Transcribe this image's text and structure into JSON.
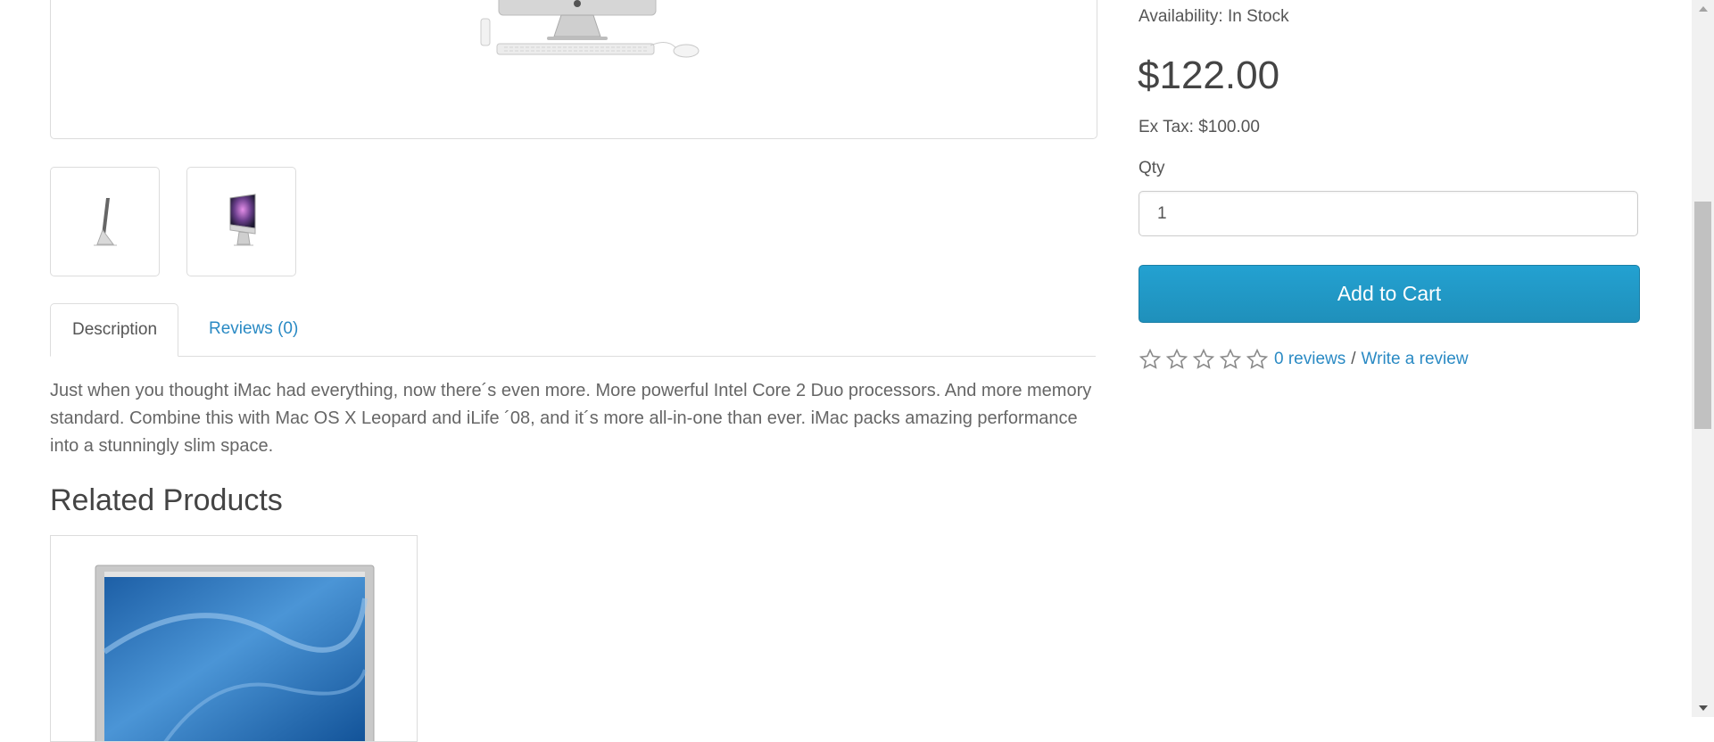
{
  "product_gallery": {
    "main_image_icon": "imac-with-keyboard-and-mouse",
    "thumbnails": [
      {
        "icon": "imac-side-view-thumbnail"
      },
      {
        "icon": "imac-front-view-thumbnail"
      }
    ]
  },
  "tabs": [
    {
      "label": "Description",
      "active": true
    },
    {
      "label": "Reviews (0)",
      "active": false
    }
  ],
  "description": "Just when you thought iMac had everything, now there´s even more. More powerful Intel Core 2 Duo processors. And more memory standard. Combine this with Mac OS X Leopard and iLife ´08, and it´s more all-in-one than ever. iMac packs amazing performance into a stunningly slim space.",
  "related": {
    "title": "Related Products",
    "product_image_icon": "apple-cinema-display-blue-wallpaper"
  },
  "product_info": {
    "availability": "Availability: In Stock",
    "price": "$122.00",
    "ex_tax": "Ex Tax: $100.00",
    "qty_label": "Qty",
    "qty_value": "1",
    "add_to_cart": "Add to Cart"
  },
  "rating": {
    "stars_filled": 0,
    "stars_total": 5,
    "reviews_link": "0 reviews",
    "separator": "/",
    "write_review": "Write a review"
  },
  "colors": {
    "accent": "#229ac8",
    "link": "#2a8ac4",
    "text": "#555555",
    "border": "#dcdcdc"
  }
}
